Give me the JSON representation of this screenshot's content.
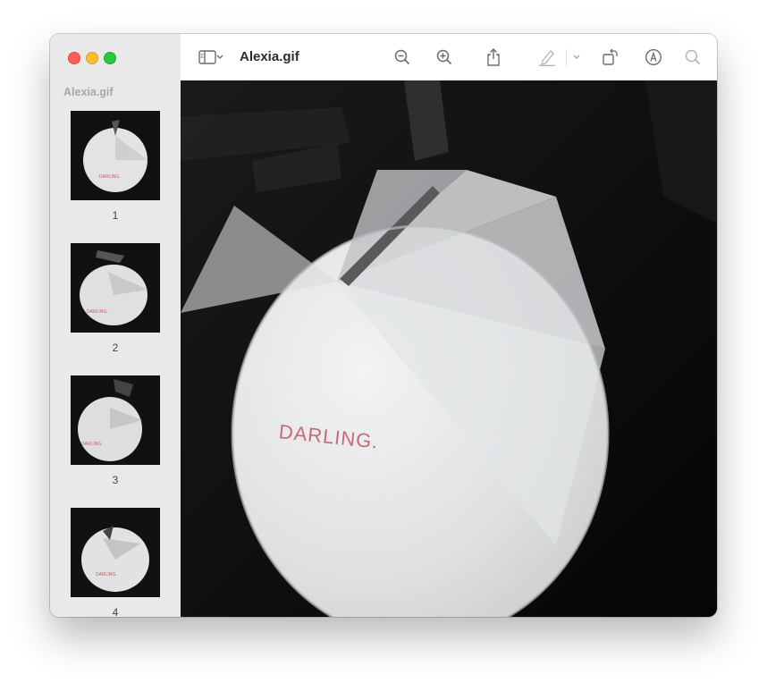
{
  "window": {
    "title": "Alexia.gif"
  },
  "sidebar": {
    "title": "Alexia.gif",
    "pages": [
      {
        "number": "1"
      },
      {
        "number": "2"
      },
      {
        "number": "3"
      },
      {
        "number": "4"
      }
    ]
  },
  "toolbar": {
    "icons": [
      "sidebar-toggle-icon",
      "chevron-down-icon",
      "zoom-out-icon",
      "zoom-in-icon",
      "share-icon",
      "highlight-pen-icon",
      "chevron-down-icon",
      "rotate-icon",
      "markup-icon",
      "search-icon"
    ]
  },
  "image": {
    "text": "DARLING."
  }
}
